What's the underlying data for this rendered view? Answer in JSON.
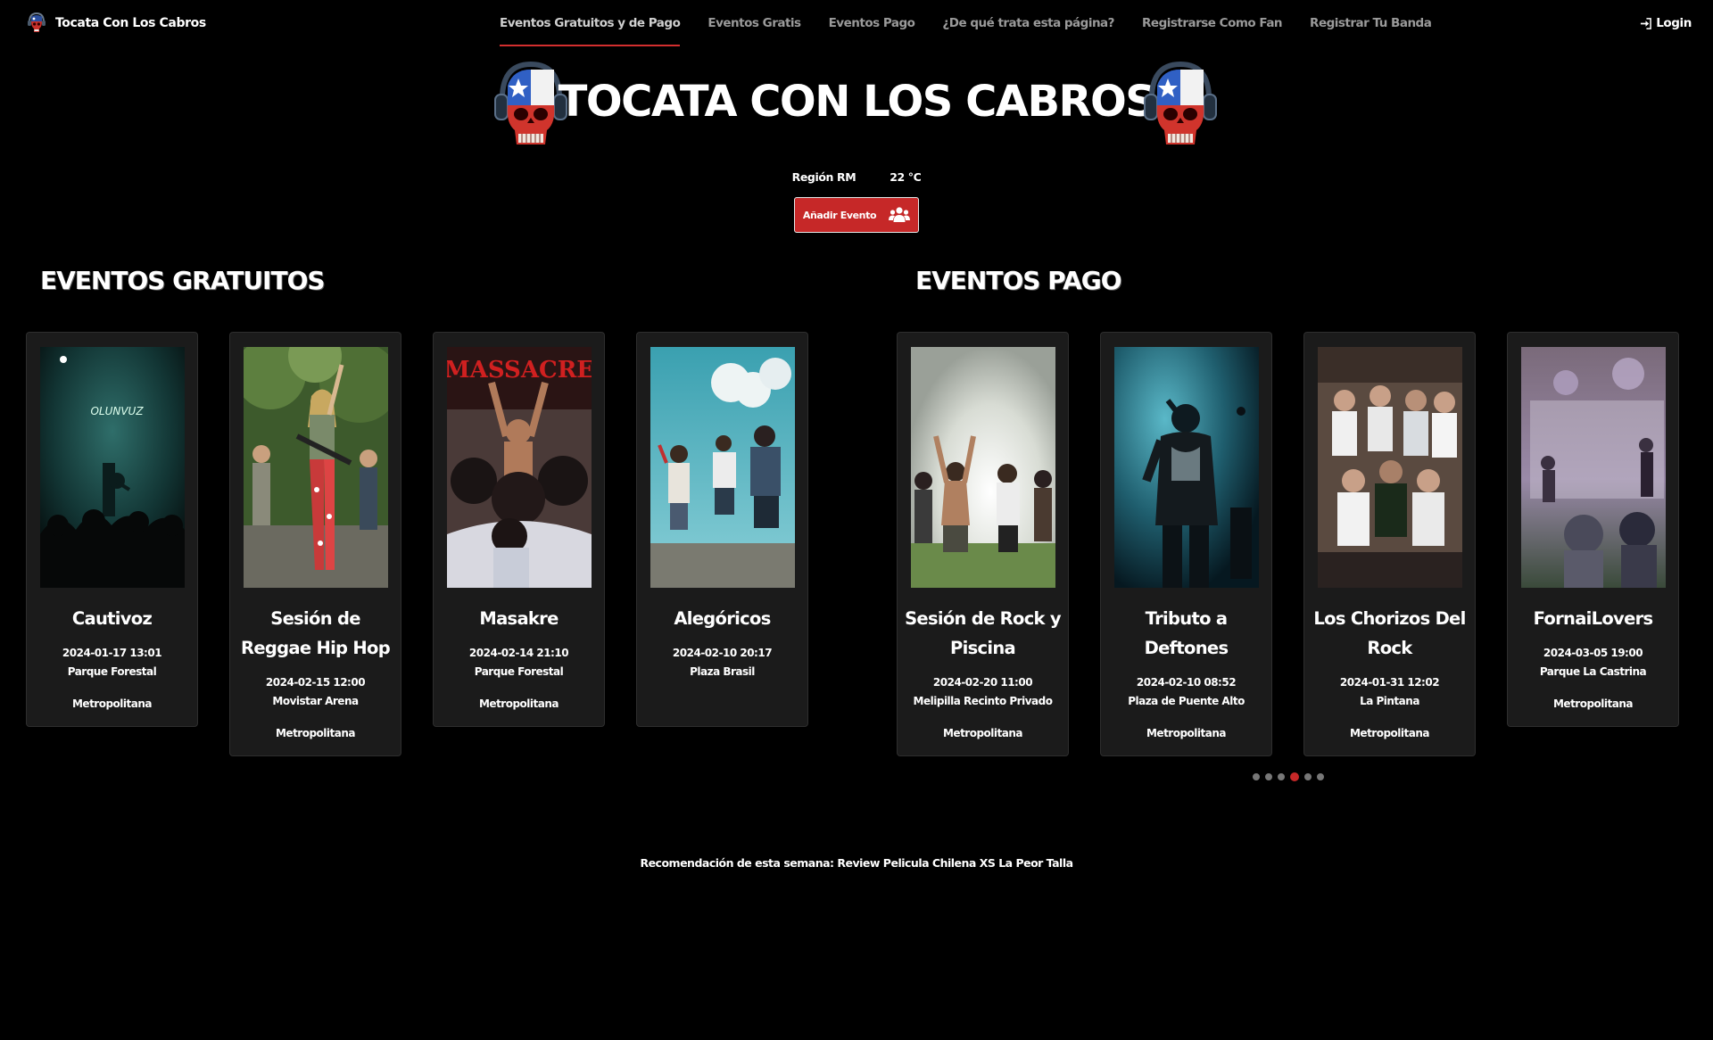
{
  "brand": {
    "name": "Tocata Con Los Cabros",
    "icon": "skull-headphones-icon"
  },
  "nav": {
    "links": [
      {
        "label": "Eventos Gratuitos y de Pago",
        "active": true
      },
      {
        "label": "Eventos Gratis"
      },
      {
        "label": "Eventos Pago"
      },
      {
        "label": "¿De qué trata esta página?"
      },
      {
        "label": "Registrarse Como Fan"
      },
      {
        "label": "Registrar Tu Banda"
      }
    ],
    "login": {
      "label": "Login",
      "icon": "sign-in-icon"
    }
  },
  "hero": {
    "title": "TOCATA CON LOS CABROS",
    "icon": "skull-headphones-chile-flag-icon"
  },
  "weather": {
    "region": "Región RM",
    "temperature": "22 °C"
  },
  "add_event": {
    "label": "Añadir Evento",
    "icon": "users-icon"
  },
  "free_events": {
    "title": "EVENTOS GRATUITOS",
    "cards": [
      {
        "title": "Cautivoz",
        "date": "2024-01-17 13:01",
        "venue": "Parque Forestal",
        "region": "Metropolitana",
        "image": "band-on-stage-teal-photo"
      },
      {
        "title": "Sesión de Reggae Hip Hop",
        "date": "2024-02-15 12:00",
        "venue": "Movistar Arena",
        "region": "Metropolitana",
        "image": "outdoor-guitarist-crowd-photo"
      },
      {
        "title": "Masakre",
        "date": "2024-02-14 21:10",
        "venue": "Parque Forestal",
        "region": "Metropolitana",
        "image": "massacre-punk-crowd-photo",
        "image_text": "MASSACRE"
      },
      {
        "title": "Alegóricos",
        "date": "2024-02-10 20:17",
        "venue": "Plaza Brasil",
        "region": "",
        "image": "fans-looking-at-sky-photo"
      }
    ]
  },
  "paid_events": {
    "title": "EVENTOS PAGO",
    "cards": [
      {
        "title": "Sesión de Rock y Piscina",
        "date": "2024-02-20 11:00",
        "venue": "Melipilla Recinto Privado",
        "region": "Metropolitana",
        "image": "crowd-hands-up-bright-stage-photo"
      },
      {
        "title": "Tributo a Deftones",
        "date": "2024-02-10 08:52",
        "venue": "Plaza de Puente Alto",
        "region": "Metropolitana",
        "image": "singer-teal-smoke-photo"
      },
      {
        "title": "Los Chorizos Del Rock",
        "date": "2024-01-31 12:02",
        "venue": "La Pintana",
        "region": "Metropolitana",
        "image": "group-of-friends-photo"
      },
      {
        "title": "FornaiLovers",
        "date": "2024-03-05 19:00",
        "venue": "Parque La Castrina",
        "region": "Metropolitana",
        "image": "blurry-outdoor-concert-photo"
      }
    ]
  },
  "carousel": {
    "count": 6,
    "active_index": 3
  },
  "recommendation": {
    "prefix": "Recomendación de esta semana:",
    "link": "Review Pelicula Chilena XS La Peor Talla"
  },
  "colors": {
    "accent": "#c62828",
    "background": "#000000",
    "card": "#1b1b1b"
  }
}
